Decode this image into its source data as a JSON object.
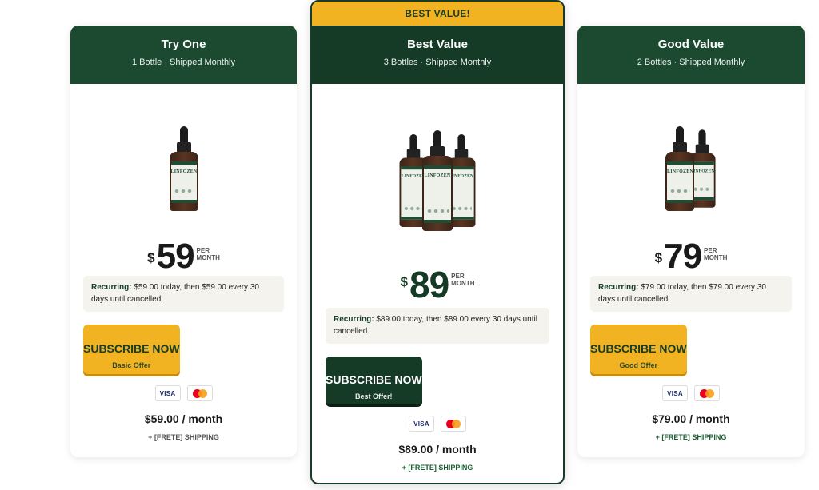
{
  "plans": {
    "one": {
      "title": "Try One",
      "subtitle": "1 Bottle · Shipped Monthly",
      "currency": "$",
      "amount": "59",
      "per_line1": "PER",
      "per_line2": "MONTH",
      "recurring_label": "Recurring:",
      "recurring_text": " $59.00 today, then $59.00 every 30 days until cancelled.",
      "cta_label": "SUBSCRIBE NOW",
      "cta_sub": "Basic Offer",
      "monthly": "$59.00 / month",
      "shipping": "+ [FRETE] SHIPPING",
      "bottle_count": 1
    },
    "three": {
      "ribbon": "BEST VALUE!",
      "title": "Best Value",
      "subtitle": "3 Bottles · Shipped Monthly",
      "currency": "$",
      "amount": "89",
      "per_line1": "PER",
      "per_line2": "MONTH",
      "recurring_label": "Recurring:",
      "recurring_text": " $89.00 today, then $89.00 every 30 days until cancelled.",
      "cta_label": "SUBSCRIBE NOW",
      "cta_sub": "Best Offer!",
      "monthly": "$89.00 / month",
      "shipping": "+ [FRETE] SHIPPING",
      "bottle_count": 3
    },
    "two": {
      "title": "Good Value",
      "subtitle": "2 Bottles · Shipped Monthly",
      "currency": "$",
      "amount": "79",
      "per_line1": "PER",
      "per_line2": "MONTH",
      "recurring_label": "Recurring:",
      "recurring_text": " $79.00 today, then $79.00 every 30 days until cancelled.",
      "cta_label": "SUBSCRIBE NOW",
      "cta_sub": "Good Offer",
      "monthly": "$79.00 / month",
      "shipping": "+ [FRETE] SHIPPING",
      "bottle_count": 2
    }
  },
  "product": {
    "label_word": "LINFOZEN"
  },
  "payment": {
    "visa": "VISA",
    "mastercard_icon": "mastercard-icon"
  },
  "colors": {
    "header_green": "#1b4a30",
    "featured_green": "#153a25",
    "accent_yellow": "#f2b323",
    "recurring_bg": "#f4f3ee"
  }
}
